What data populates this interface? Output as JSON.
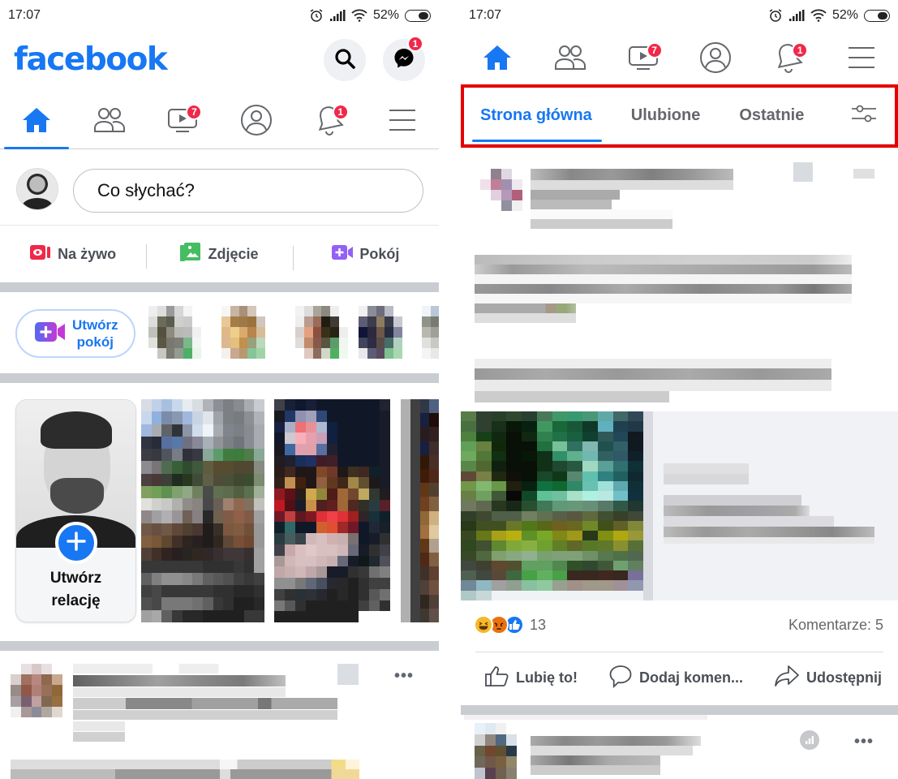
{
  "status_bar": {
    "time": "17:07",
    "battery": "52%",
    "battery_level": 0.52
  },
  "left": {
    "logo": "facebook",
    "header_buttons": [
      {
        "name": "search",
        "icon": "search-icon"
      },
      {
        "name": "messenger",
        "icon": "messenger-icon",
        "badge": "1"
      }
    ],
    "nav": [
      {
        "name": "home",
        "icon": "home-icon",
        "active": true
      },
      {
        "name": "friends",
        "icon": "friends-icon"
      },
      {
        "name": "watch",
        "icon": "watch-icon",
        "badge": "7"
      },
      {
        "name": "profile",
        "icon": "profile-icon"
      },
      {
        "name": "notifications",
        "icon": "bell-icon",
        "badge": "1"
      },
      {
        "name": "menu",
        "icon": "menu-icon"
      }
    ],
    "composer": {
      "placeholder": "Co słychać?"
    },
    "composer_actions": [
      {
        "label": "Na żywo",
        "icon": "live-video-icon",
        "color": "#f02849"
      },
      {
        "label": "Zdjęcie",
        "icon": "photo-icon",
        "color": "#45bd62"
      },
      {
        "label": "Pokój",
        "icon": "room-icon",
        "color": "#9360f7"
      }
    ],
    "create_room": {
      "label_line1": "Utwórz",
      "label_line2": "pokój"
    },
    "create_story": {
      "label_line1": "Utwórz",
      "label_line2": "relację"
    },
    "post_more": "•••"
  },
  "right": {
    "nav": [
      {
        "name": "home",
        "icon": "home-icon",
        "active": true
      },
      {
        "name": "friends",
        "icon": "friends-icon"
      },
      {
        "name": "watch",
        "icon": "watch-icon",
        "badge": "7"
      },
      {
        "name": "profile",
        "icon": "profile-icon"
      },
      {
        "name": "notifications",
        "icon": "bell-icon",
        "badge": "1"
      },
      {
        "name": "menu",
        "icon": "menu-icon"
      }
    ],
    "feed_tabs": [
      {
        "label": "Strona główna",
        "active": true
      },
      {
        "label": "Ulubione"
      },
      {
        "label": "Ostatnie"
      }
    ],
    "feed_filter_icon": "filter-sliders-icon",
    "post": {
      "reactions": [
        "haha",
        "angry",
        "like"
      ],
      "reaction_count": "13",
      "comments": "Komentarze: 5",
      "actions": [
        {
          "label": "Lubię to!",
          "icon": "like-icon"
        },
        {
          "label": "Dodaj komen...",
          "icon": "comment-icon"
        },
        {
          "label": "Udostępnij",
          "icon": "share-icon"
        }
      ]
    },
    "post_more": "•••"
  },
  "colors": {
    "brand": "#1877f2",
    "badge": "#f02849",
    "highlight_box": "#e60000",
    "separator": "#c9ccd1"
  }
}
